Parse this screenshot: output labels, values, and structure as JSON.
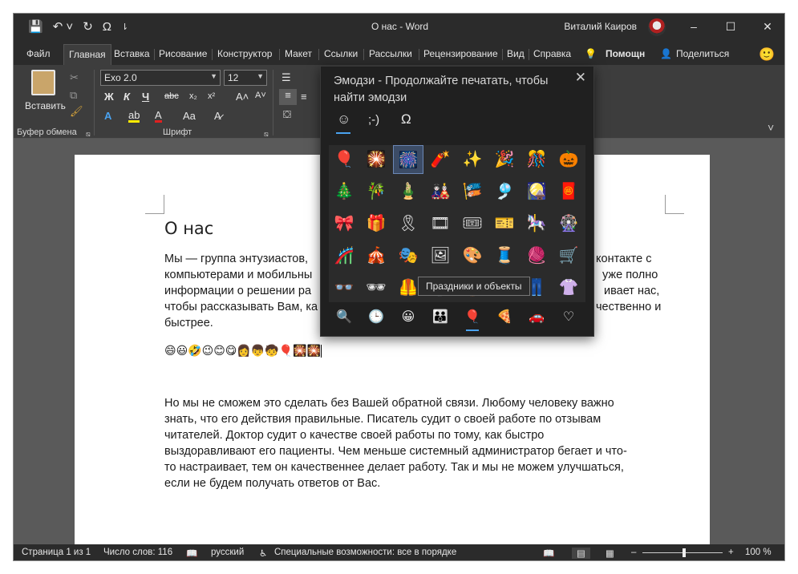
{
  "window": {
    "title": "О нас  -  Word",
    "user": "Виталий Каиров",
    "minimize": "–",
    "maximize": "☐",
    "close": "✕",
    "help_icon": "?"
  },
  "qat": {
    "save": "💾",
    "undo": "↶ ˅",
    "redo": "↻",
    "symbol": "Ω",
    "customize": "⇂"
  },
  "tabs": [
    "Файл",
    "Главная",
    "Вставка",
    "Рисование",
    "Конструктор",
    "Макет",
    "Ссылки",
    "Рассылки",
    "Рецензирование",
    "Вид",
    "Справка"
  ],
  "tell_me": "Помощн",
  "share": "Поделиться",
  "smiley": "🙂",
  "ribbon": {
    "paste_label": "Вставить",
    "clipboard_label": "Буфер обмена",
    "font_label": "Шрифт",
    "font_name": "Exo 2.0",
    "font_size": "12",
    "bold": "Ж",
    "italic": "К",
    "underline": "Ч",
    "strike": "abc",
    "subscript": "x₂",
    "superscript": "x²",
    "case": "Aa",
    "grow": "A˄",
    "shrink": "A˅",
    "text_effects": "A",
    "highlight": "ab",
    "font_color": "A",
    "collapse": "˅"
  },
  "document": {
    "title": "О нас",
    "p1_l1": "Мы — группа энтузиастов, ",
    "p1_l1b": "контакте с",
    "p1_l2": "компьютерами и мобильны",
    "p1_l2b": "уже полно",
    "p1_l3": "информации о решении ра",
    "p1_l3b": "ивает нас,",
    "p1_l4": "чтобы рассказывать Вам, ка",
    "p1_l4b": "чественно и",
    "p1_l5": "быстрее.",
    "emojis": "😄😃🤣😉😊😋👩👦🧒🎈🎇🎇",
    "p2": [
      "Но мы не сможем это сделать без Вашей обратной связи. Любому человеку важно",
      "знать, что его действия правильные. Писатель судит о своей работе по отзывам",
      "читателей. Доктор судит о качестве своей работы по тому, как быстро",
      "выздоравливают его пациенты. Чем меньше системный администратор бегает и что-",
      "то настраивает, тем он качественнее делает работу. Так и мы не можем улучшаться,",
      "если не будем получать ответов от Вас."
    ]
  },
  "status": {
    "page": "Страница 1 из 1",
    "words": "Число слов: 116",
    "language": "русский",
    "accessibility": "Специальные возможности: все в порядке",
    "zoom": "100 %",
    "zoom_out": "–",
    "zoom_in": "+"
  },
  "emoji_panel": {
    "title": "Эмодзи - Продолжайте печатать, чтобы найти эмодзи",
    "close": "✕",
    "categories": [
      "☺",
      ";-)",
      "Ω"
    ],
    "grid": [
      [
        "🎈",
        "🎇",
        "🎆",
        "🧨",
        "✨",
        "🎉",
        "🎊",
        "🎃"
      ],
      [
        "🎄",
        "🎋",
        "🎍",
        "🎎",
        "🎏",
        "🎐",
        "🎑",
        "🧧"
      ],
      [
        "🎀",
        "🎁",
        "🎗",
        "🎞",
        "🎟",
        "🎫",
        "🎠",
        "🎡"
      ],
      [
        "🎢",
        "🎪",
        "🎭",
        "🖼",
        "🎨",
        "🧵",
        "🧶",
        "🛒"
      ],
      [
        "👓",
        "🕶",
        "🦺",
        "🥼",
        "👔",
        "👕",
        "👖",
        "👚"
      ]
    ],
    "tabs": [
      "🔍",
      "🕒",
      "😀",
      "👪",
      "🎈",
      "🍕",
      "🚗",
      "♡"
    ],
    "tooltip": "Праздники и объекты"
  }
}
